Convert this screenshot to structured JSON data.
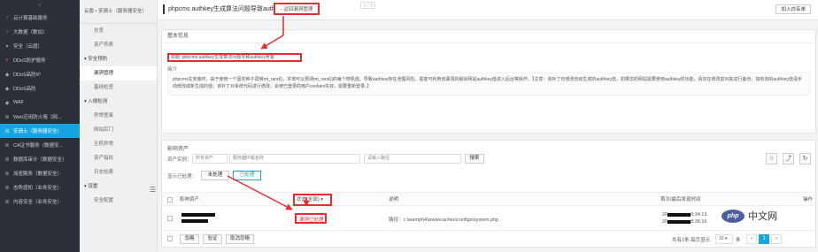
{
  "sidebar": {
    "top_label": "≡",
    "items": [
      {
        "icon": "›",
        "label": "云计算基础服务"
      },
      {
        "icon": "›",
        "label": "大数据（数加）"
      },
      {
        "icon": "▾",
        "label": "安全（云盾）"
      },
      {
        "icon": "●",
        "label": "DDoS防护服务"
      },
      {
        "icon": "◆",
        "label": "DDoS高防IP"
      },
      {
        "icon": "◆",
        "label": "DDoS高防"
      },
      {
        "icon": "◆",
        "label": "WAF"
      },
      {
        "icon": "⊕",
        "label": "Web应用防火墙（网..."
      },
      {
        "icon": "⊙",
        "label": "安骑士（服务器安全）"
      },
      {
        "icon": "⊕",
        "label": "CA证书服务（数据安..."
      },
      {
        "icon": "⊕",
        "label": "数据库审计（数据安全）"
      },
      {
        "icon": "⊕",
        "label": "加密服务（数据安全）"
      },
      {
        "icon": "⊕",
        "label": "态势感知（业务安全）"
      },
      {
        "icon": "⊕",
        "label": "内容安全（业务安全）"
      }
    ]
  },
  "submenu": {
    "header": "云盾 • 安骑士（服务器安全）",
    "items": [
      {
        "label": "总览",
        "type": "lvl1"
      },
      {
        "label": "资产列表",
        "type": "lvl1"
      },
      {
        "label": "▾ 安全预防",
        "type": "group"
      },
      {
        "label": "漏洞管理",
        "type": "lvl1"
      },
      {
        "label": "基线检查",
        "type": "lvl1"
      },
      {
        "label": "▾ 入侵检测",
        "type": "group"
      },
      {
        "label": "异常登录",
        "type": "lvl1"
      },
      {
        "label": "网站后门",
        "type": "lvl1"
      },
      {
        "label": "主机异常",
        "type": "lvl1"
      },
      {
        "label": "资产指纹",
        "type": "lvl1"
      },
      {
        "label": "日志检索",
        "type": "lvl1"
      },
      {
        "label": "▾ 设置",
        "type": "group"
      },
      {
        "label": "安全配置",
        "type": "lvl1"
      }
    ],
    "toggle": "☰"
  },
  "topbar": {
    "title": "phpcms authkey生成算法问题导致authkey泄露",
    "back_label": "‹ 返回漏洞管理",
    "mini_label": "( ⌂ )",
    "export_label": "加入白名单"
  },
  "basic_info": {
    "section_title": "基本信息",
    "title_value": "标题: phpcms authkey生成算法问题导致authkey泄露",
    "intro_label": "简介",
    "intro_text": "phpcms在安装时，由于使用一个固定种子调用mt_rand()，本地可以预测mt_rand()的每个随机值。导致authkey存在泄露风险，黑客可利用该漏洞的解出网站authkey值进入后台等操作。【注意：该补丁仅修改自动生成的authkey值，如果您的网站需要使用authkey的功能，请勿在修改前对其进行备份，如有旧的authkey值请手动修改成新生成的值；该补丁对系统代码进行修改，会使已登录的用户cookies失效，需要重新登录。】"
  },
  "affected": {
    "section_title": "影响资产",
    "filter_label": "资产实例：",
    "select_all": "所有资产",
    "search_placeholder": "服务器IP或名称",
    "search2_placeholder": "请输入路径",
    "search_button": "搜索",
    "status_label": "显示已处理：",
    "tab_unhandled": "未处理",
    "tab_handled": "已处理",
    "columns": {
      "asset": "影响资产",
      "status": "状态(全部) ▾",
      "detail": "说明",
      "time": "首次/最后发现时间",
      "op": "操作"
    },
    "row": {
      "status": "漏洞已处理",
      "path": "路径：c:\\wamp64\\www\\caches\\configs\\system.php",
      "first_time": "20",
      "first_suffix": "0:34:13",
      "last_time": "20",
      "last_suffix": "8:35:16"
    },
    "footer": {
      "btn1": "忽略",
      "btn2": "验证",
      "btn3": "取消忽略",
      "paging": "共有1条,每页显示",
      "page_size": "10 ▾",
      "unit": "条",
      "prev": "‹",
      "page": "1",
      "next": "›"
    },
    "actions": {
      "star": "☆",
      "export": "⤴",
      "refresh": "↻"
    }
  },
  "watermark": {
    "logo_text": "php",
    "text": "中文网"
  },
  "colors": {
    "accent": "#16a5e0",
    "highlight": "#e62e2e",
    "sidebar": "#2c3038"
  }
}
